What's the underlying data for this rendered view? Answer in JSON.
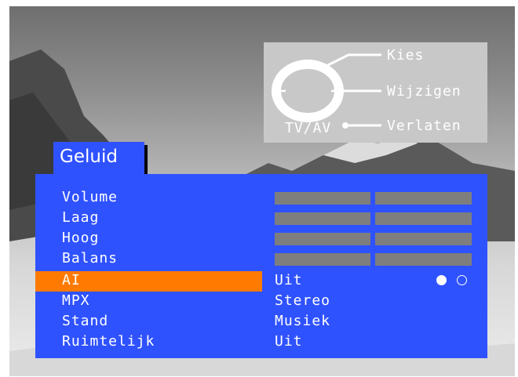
{
  "screen": {
    "title": "Geluid"
  },
  "help": {
    "select": "Kies",
    "change": "Wijzigen",
    "exit": "Verlaten",
    "tvav": "TV/AV"
  },
  "menu": {
    "items": [
      {
        "label": "Volume",
        "value": "",
        "level": null
      },
      {
        "label": "Laag",
        "value": "",
        "level": null
      },
      {
        "label": "Hoog",
        "value": "",
        "level": null
      },
      {
        "label": "Balans",
        "value": "",
        "level": null
      },
      {
        "label": "AI",
        "value": "Uit",
        "selected": true
      },
      {
        "label": "MPX",
        "value": "Stereo"
      },
      {
        "label": "Stand",
        "value": "Musiek"
      },
      {
        "label": "Ruimtelijk",
        "value": "Uit"
      }
    ]
  },
  "colors": {
    "panel": "#2f52ff",
    "selection": "#ff7a00",
    "text": "#ffffff",
    "bar": "#7e7e7e"
  }
}
